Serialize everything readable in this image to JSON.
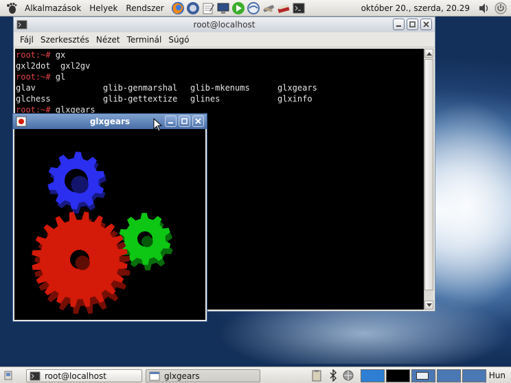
{
  "top_panel": {
    "menus": [
      "Alkalmazások",
      "Helyek",
      "Rendszer"
    ],
    "clock": "október 20., szerda, 20.29"
  },
  "terminal": {
    "title": "root@localhost",
    "menu": [
      "Fájl",
      "Szerkesztés",
      "Nézet",
      "Terminál",
      "Súgó"
    ],
    "lines": [
      {
        "prompt": "root:~# ",
        "text": "gx"
      },
      {
        "prompt": "",
        "text": "gxl2dot  gxl2gv"
      },
      {
        "prompt": "root:~# ",
        "text": "gl"
      },
      {
        "prompt": "",
        "text": "",
        "cols": [
          "glav",
          "glib-genmarshal",
          "glib-mkenums",
          "glxgears"
        ]
      },
      {
        "prompt": "",
        "text": "",
        "cols": [
          "glchess",
          "glib-gettextize",
          "glines",
          "glxinfo"
        ]
      },
      {
        "prompt": "root:~# ",
        "text": "glxgears"
      }
    ]
  },
  "glxgears": {
    "title": "glxgears",
    "gear_colors": {
      "red": "#d41a08",
      "green": "#0ec614",
      "blue": "#2b2ff0"
    }
  },
  "taskbar": {
    "tasks": [
      "root@localhost",
      "glxgears"
    ],
    "language": "Hun"
  }
}
